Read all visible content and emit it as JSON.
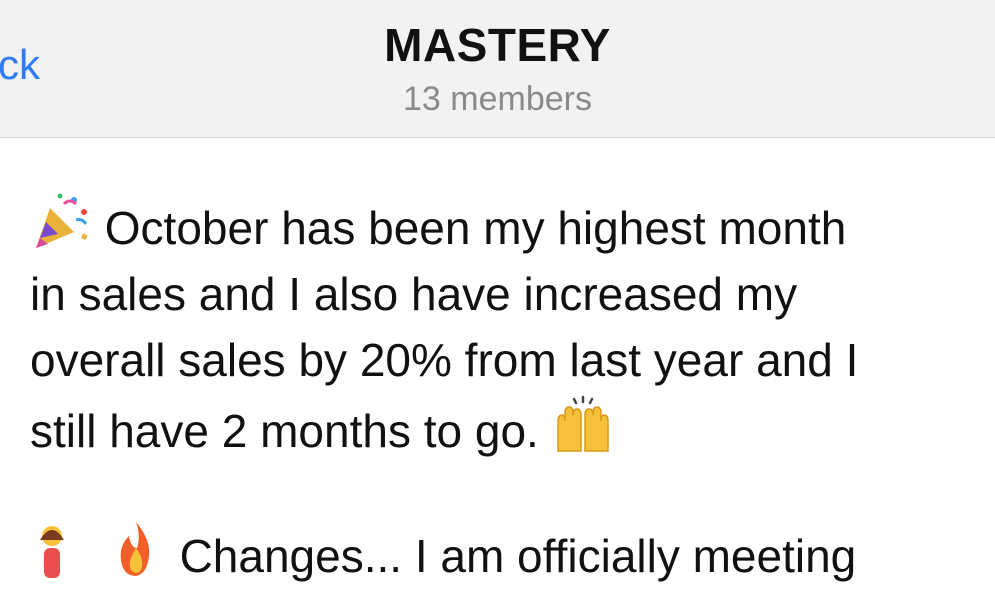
{
  "header": {
    "back_label": "ck",
    "title": "MASTERY",
    "subtitle": "13 members"
  },
  "messages": [
    {
      "emoji_start": "party-popper-icon",
      "text_line1": "October has been my highest month",
      "text_line2": "in sales and I also have increased my",
      "text_line3": "overall sales by 20% from last year and I",
      "text_line4": "still have 2 months to go.",
      "emoji_end": "raising-hands-icon"
    },
    {
      "emoji_start": [
        "person-icon",
        "fire-icon"
      ],
      "text_partial": "Changes... I am officially meeting"
    }
  ],
  "colors": {
    "accent": "#2f7bf5",
    "header_bg": "#f2f2f2",
    "text": "#111111",
    "muted": "#8a8a8a"
  }
}
